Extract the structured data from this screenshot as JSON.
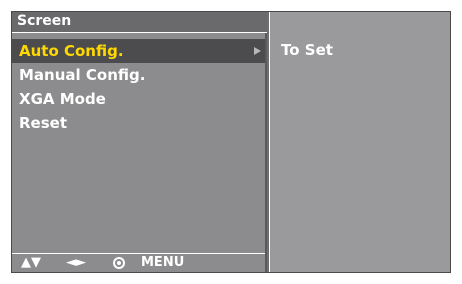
{
  "screen": {
    "title": "Screen"
  },
  "menu": {
    "items": [
      {
        "label": "Auto Config.",
        "selected": true
      },
      {
        "label": "Manual Config."
      },
      {
        "label": "XGA Mode"
      },
      {
        "label": "Reset"
      }
    ]
  },
  "submenu": {
    "label": "To Set"
  },
  "nav": {
    "updown": "▲▼",
    "leftright": "◄►",
    "ok_icon": "ok-button-icon",
    "menu": "MENU"
  },
  "colors": {
    "selected_text": "#ffd800",
    "selected_bg": "#4c4c4e",
    "panel_bg": "#8c8c8e",
    "right_bg": "#9a9a9c"
  }
}
